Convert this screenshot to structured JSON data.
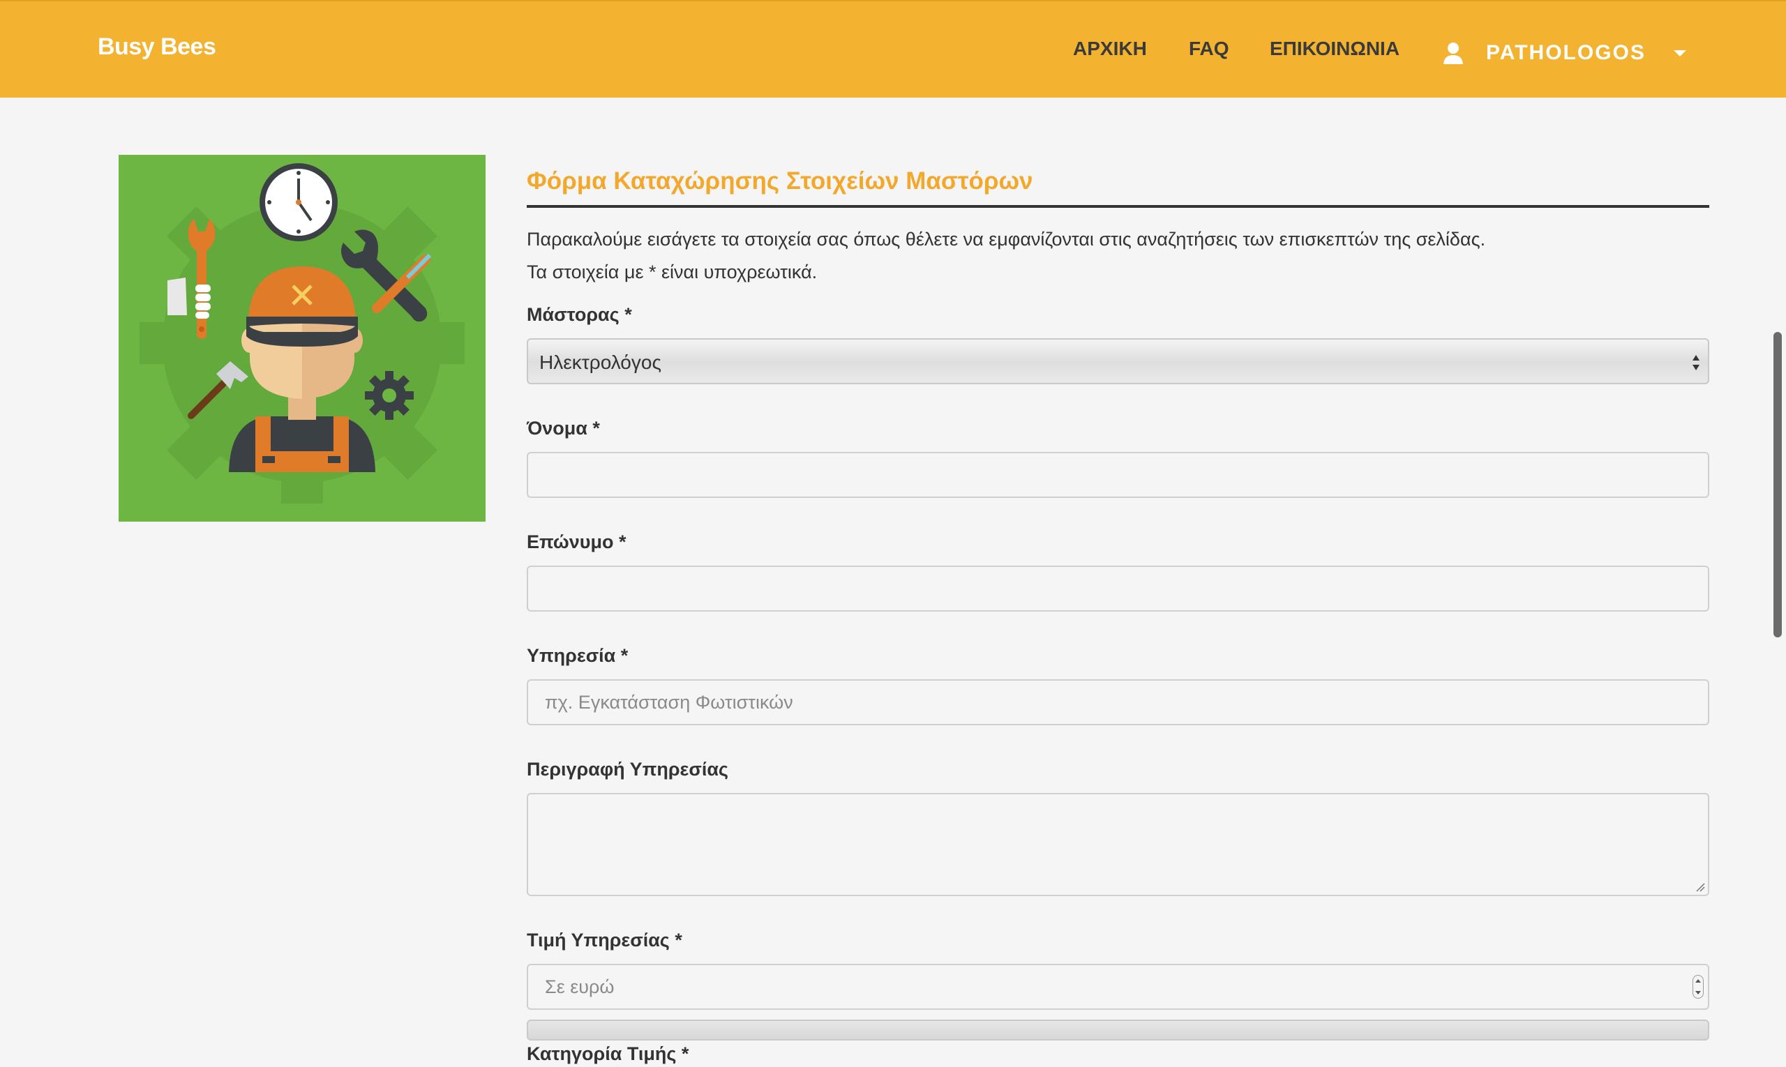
{
  "navbar": {
    "brand": "Busy Bees",
    "links": [
      "ΑΡΧΙΚΗ",
      "FAQ",
      "ΕΠΙΚΟΙΝΩΝΙΑ"
    ],
    "user": "PATHOLOGOS",
    "color": "#f3b22f"
  },
  "form": {
    "title": "Φόρμα Καταχώρησης Στοιχείων Μαστόρων",
    "intro_line1": "Παρακαλούμε εισάγετε τα στοιχεία σας όπως θέλετε να εμφανίζονται στις αναζητήσεις των επισκεπτών της σελίδας.",
    "intro_line2": "Τα στοιχεία με * είναι υποχρεωτικά.",
    "fields": {
      "mastoras": {
        "label": "Μάστορας *",
        "value": "Ηλεκτρολόγος"
      },
      "onoma": {
        "label": "Όνομα *",
        "value": ""
      },
      "eponymo": {
        "label": "Επώνυμο *",
        "value": ""
      },
      "ypiresia": {
        "label": "Υπηρεσία *",
        "placeholder": "πχ. Εγκατάσταση Φωτιστικών"
      },
      "perigrafi": {
        "label": "Περιγραφή Υπηρεσίας"
      },
      "timi": {
        "label": "Τιμή Υπηρεσίας *",
        "placeholder": "Σε ευρώ"
      },
      "katigoria": {
        "label": "Κατηγορία Τιμής *"
      }
    },
    "accent_color": "#f3a82c"
  },
  "icons": [
    "user-icon",
    "caret-down-icon",
    "worker-illustration",
    "clock-icon",
    "wrench-icon",
    "screwdriver-wrench-icon",
    "hammer-icon",
    "gear-icon"
  ]
}
